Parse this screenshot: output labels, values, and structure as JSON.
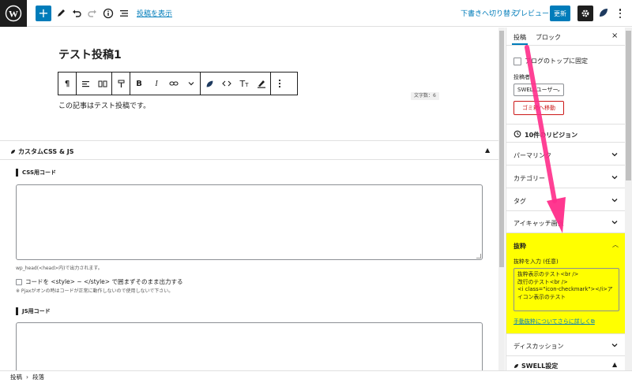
{
  "topbar": {
    "show_post_link": "投稿を表示",
    "switch_to_draft": "下書きへ切り替え",
    "preview": "プレビュー",
    "update": "更新"
  },
  "editor": {
    "post_title": "テスト投稿1",
    "char_count": "文字数：6",
    "paragraph": "この記事はテスト投稿です。"
  },
  "metabox": {
    "title": "カスタムCSS & JS",
    "css_label": "CSS用コード",
    "css_hint": "wp_head(<head>内)で出力されます。",
    "checkbox_label": "コードを <style> ~ </style> で囲まずそのまま出力する",
    "pjax_note": "※ Pjaxがオンの時はコードが正常に動作しないので使用しないで下さい。",
    "js_label": "JS用コード"
  },
  "footer": {
    "crumb_1": "投稿",
    "separator": "›",
    "crumb_2": "段落"
  },
  "sidebar": {
    "tab_post": "投稿",
    "tab_block": "ブロック",
    "close": "×",
    "stick_to_top": "ブログのトップに固定",
    "author_label": "投稿者",
    "author_value": "SWELLユーザー",
    "trash": "ゴミ箱へ移動",
    "revisions": "10件のリビジョン",
    "permalink": "パーマリンク",
    "category": "カテゴリー",
    "tag": "タグ",
    "featured_image": "アイキャッチ画像",
    "excerpt_title": "抜粋",
    "excerpt_input_label": "抜粋を入力 (任意)",
    "excerpt_text": "抜粋表示のテスト<br />\n改行のテスト<br />\n<i class=\"icon-checkmark\"></i>アイコン表示のテスト",
    "excerpt_link": "手動抜粋についてさらに詳しく",
    "discussion": "ディスカッション",
    "swell_settings": "SWELL設定"
  },
  "colors": {
    "accent": "#007cba",
    "highlight": "#ffff00",
    "arrow": "#ff2d8a",
    "danger": "#cc1818"
  }
}
